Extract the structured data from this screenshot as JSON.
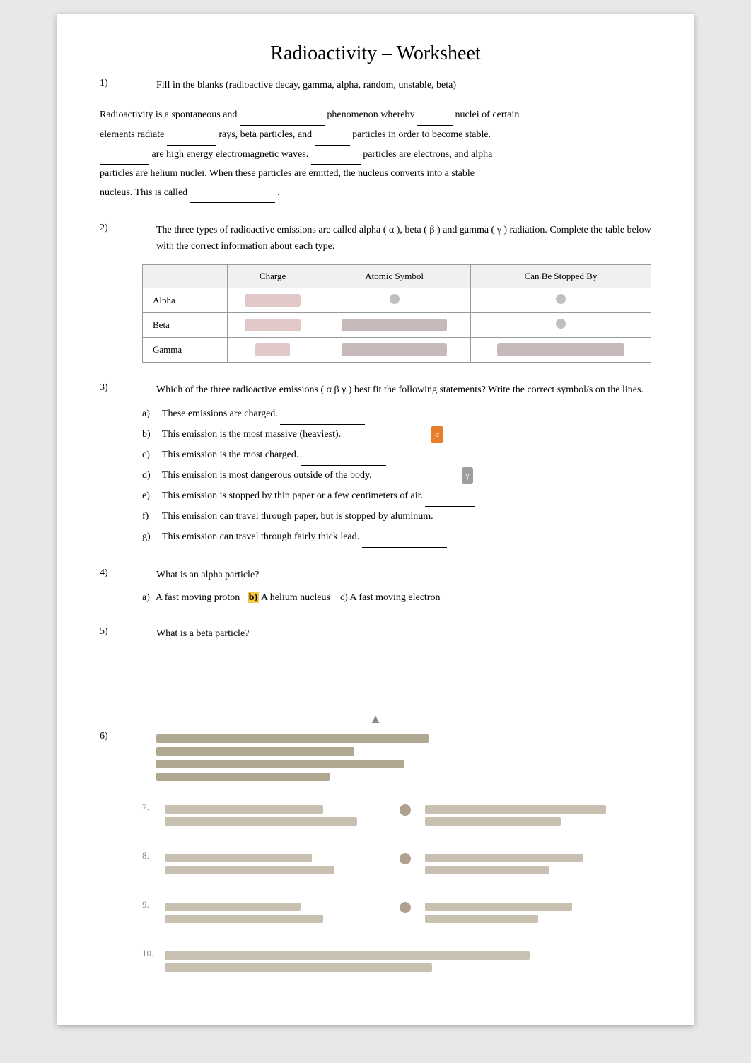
{
  "title": "Radioactivity – Worksheet",
  "q1": {
    "num": "1)",
    "text": "Fill in the blanks (radioactive decay, gamma, alpha, random, unstable, beta)"
  },
  "paragraph": {
    "line1a": "Radioactivity is a spontaneous and",
    "blank1": "",
    "line1b": "phenomenon whereby",
    "blank2": "",
    "line1c": "nuclei of certain",
    "line2a": "elements radiate",
    "blank3": "",
    "line2b": "rays, beta particles, and",
    "blank4": "",
    "line2c": "particles in order to become stable.",
    "line3a": "",
    "blank5": "",
    "line3b": "are high energy electromagnetic waves.",
    "blank6": "",
    "line3c": "particles are electrons, and alpha",
    "line4": "particles are helium nuclei. When these particles are emitted, the nucleus converts into a stable",
    "line5a": "nucleus. This is called",
    "blank7": "",
    "line5b": "."
  },
  "q2": {
    "num": "2)",
    "text": "The three types of radioactive emissions are called alpha ( α ), beta ( β ) and gamma ( γ ) radiation. Complete the table below with the correct information about each type.",
    "table": {
      "headers": [
        "",
        "Charge",
        "Atomic Symbol",
        "Can Be Stopped By"
      ],
      "rows": [
        {
          "type": "Alpha",
          "charge": "BLURRED",
          "symbol": "•",
          "stopped": "•"
        },
        {
          "type": "Beta",
          "charge": "BLURRED",
          "symbol": "BLURRED",
          "stopped": "•"
        },
        {
          "type": "Gamma",
          "charge": "BLURRED",
          "symbol": "BLURRED",
          "stopped": "BLURRED"
        }
      ]
    }
  },
  "q3": {
    "num": "3)",
    "text": "Which of the three radioactive emissions ( α  β  γ ) best fit the following statements? Write the correct symbol/s on the lines.",
    "items": [
      {
        "label": "a)",
        "text": "These emissions are charged."
      },
      {
        "label": "b)",
        "text": "This emission is the most massive (heaviest)."
      },
      {
        "label": "c)",
        "text": "This emission is the most charged."
      },
      {
        "label": "d)",
        "text": "This emission is most dangerous outside of the body."
      },
      {
        "label": "e)",
        "text": "This emission is stopped by thin paper or a few centimeters of air."
      },
      {
        "label": "f)",
        "text": "This emission can travel through paper, but is stopped by aluminum."
      },
      {
        "label": "g)",
        "text": "This emission can travel through fairly thick lead."
      }
    ]
  },
  "q4": {
    "num": "4)",
    "text": "What is an alpha particle?"
  },
  "q4a": {
    "label": "a)",
    "text": "A fast moving proton",
    "answer": "b)",
    "text2": "A helium nucleus   c) A fast moving electron"
  },
  "q5": {
    "num": "5)",
    "text": "What is a beta particle?"
  },
  "q6": {
    "num": "6)",
    "blurred": true
  }
}
